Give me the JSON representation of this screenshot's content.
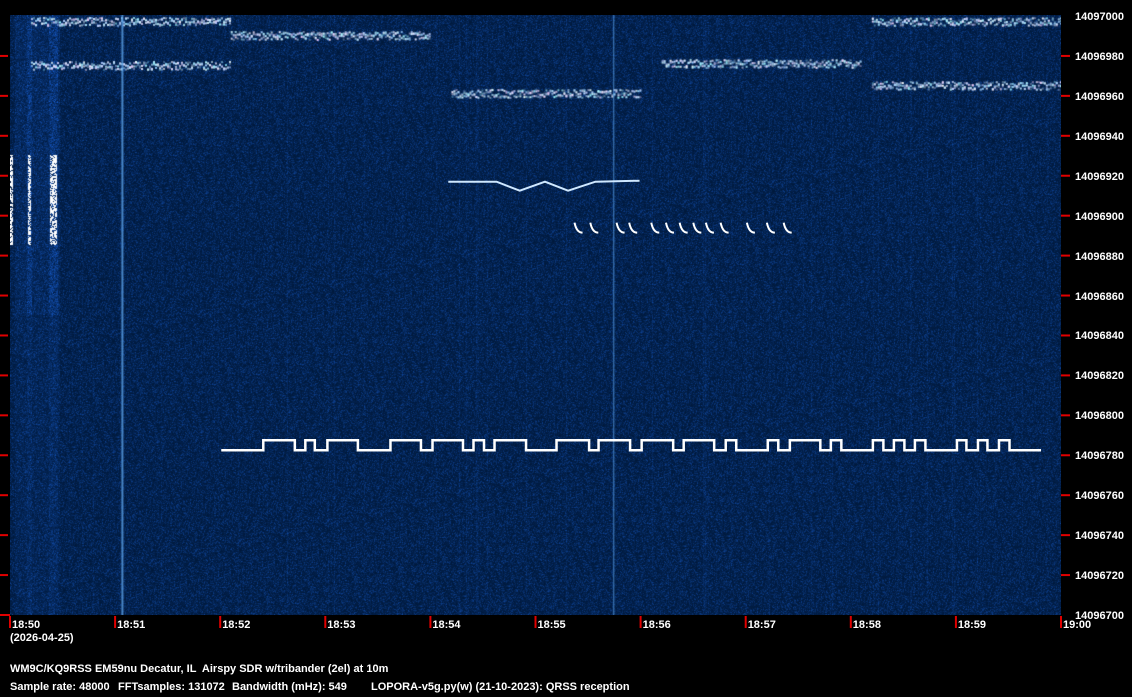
{
  "chart_data": {
    "type": "heatmap",
    "title": "QRSS waterfall spectrogram",
    "x_tick_labels": [
      "18:50",
      "18:51",
      "18:52",
      "18:53",
      "18:54",
      "18:55",
      "18:56",
      "18:57",
      "18:58",
      "18:59",
      "19:00"
    ],
    "date_label": "(2026-04-25)",
    "y_tick_labels": [
      "14097000",
      "14096980",
      "14096960",
      "14096940",
      "14096920",
      "14096900",
      "14096880",
      "14096860",
      "14096840",
      "14096820",
      "14096800",
      "14096780",
      "14096760",
      "14096740",
      "14096720",
      "14096700"
    ],
    "xlim_minutes": [
      0,
      10
    ],
    "ylim_hz": [
      14096700,
      14097000
    ],
    "fsk_trace": {
      "low_hz": 14096782,
      "high_hz": 14096787,
      "start_min": 2.01,
      "end_min": 9.81,
      "high_intervals_min": [
        [
          2.41,
          2.71
        ],
        [
          2.81,
          2.9
        ],
        [
          3.02,
          3.31
        ],
        [
          3.62,
          3.91
        ],
        [
          4.02,
          4.31
        ],
        [
          4.41,
          4.51
        ],
        [
          4.61,
          4.91
        ],
        [
          5.2,
          5.51
        ],
        [
          5.6,
          5.9
        ],
        [
          6.01,
          6.31
        ],
        [
          6.41,
          6.7
        ],
        [
          6.81,
          6.91
        ],
        [
          7.21,
          7.31
        ],
        [
          7.42,
          7.71
        ],
        [
          7.81,
          7.91
        ],
        [
          8.21,
          8.31
        ],
        [
          8.41,
          8.51
        ],
        [
          8.61,
          8.71
        ],
        [
          9.01,
          9.1
        ],
        [
          9.21,
          9.3
        ],
        [
          9.41,
          9.51
        ]
      ]
    },
    "v_trace": [
      [
        4.17,
        14096916.5
      ],
      [
        4.63,
        14096916.5
      ],
      [
        4.85,
        14096912
      ],
      [
        5.09,
        14096916.5
      ],
      [
        5.31,
        14096912
      ],
      [
        5.57,
        14096916.5
      ],
      [
        5.99,
        14096917
      ]
    ],
    "hook_trace_min": [
      5.4,
      5.55,
      5.8,
      5.92,
      6.13,
      6.27,
      6.4,
      6.53,
      6.65,
      6.79,
      7.04,
      7.23,
      7.39
    ],
    "noise_bands": [
      {
        "start_min": 0.2,
        "end_min": 2.1,
        "hz": 14096997
      },
      {
        "start_min": 2.1,
        "end_min": 4.0,
        "hz": 14096990
      },
      {
        "start_min": 0.2,
        "end_min": 2.1,
        "hz": 14096975
      },
      {
        "start_min": 4.2,
        "end_min": 6.0,
        "hz": 14096961
      },
      {
        "start_min": 6.2,
        "end_min": 8.1,
        "hz": 14096976
      },
      {
        "start_min": 8.2,
        "end_min": 10,
        "hz": 14096965
      },
      {
        "start_min": 8.2,
        "end_min": 10,
        "hz": 14096997
      }
    ],
    "colors": {
      "background": "#061a44",
      "signal": "#ffffff",
      "tick": "#e00000"
    }
  },
  "footer": {
    "station": "WM9C/KQ9RSS EM59nu Decatur, IL  Airspy SDR w/tribander (2el) at 10m",
    "sample_rate": "Sample rate: 48000",
    "fft": "FFTsamples: 131072",
    "bandwidth": "Bandwidth (mHz): 549",
    "software": "LOPORA-v5g.py(w) (21-10-2023): QRSS reception"
  }
}
